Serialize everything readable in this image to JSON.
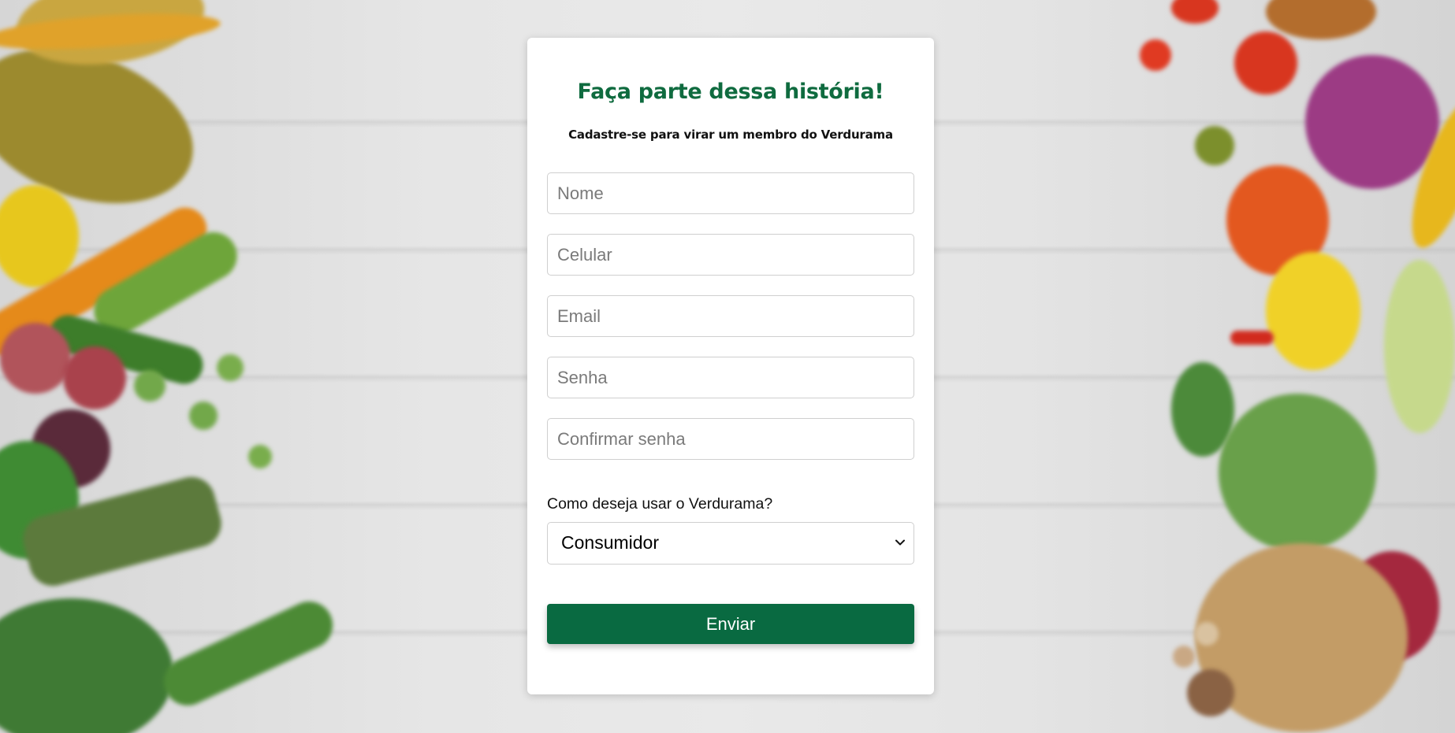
{
  "form": {
    "title": "Faça parte dessa história!",
    "subtitle": "Cadastre-se para virar um membro do Verdurama",
    "fields": {
      "name_placeholder": "Nome",
      "phone_placeholder": "Celular",
      "email_placeholder": "Email",
      "password_placeholder": "Senha",
      "confirm_password_placeholder": "Confirmar senha"
    },
    "usage_question": "Como deseja usar o Verdurama?",
    "usage_selected": "Consumidor",
    "submit_label": "Enviar"
  },
  "colors": {
    "brand_green": "#0f6b3f",
    "button_green": "#096a41"
  },
  "icons": {
    "select": "chevron-down-icon"
  }
}
